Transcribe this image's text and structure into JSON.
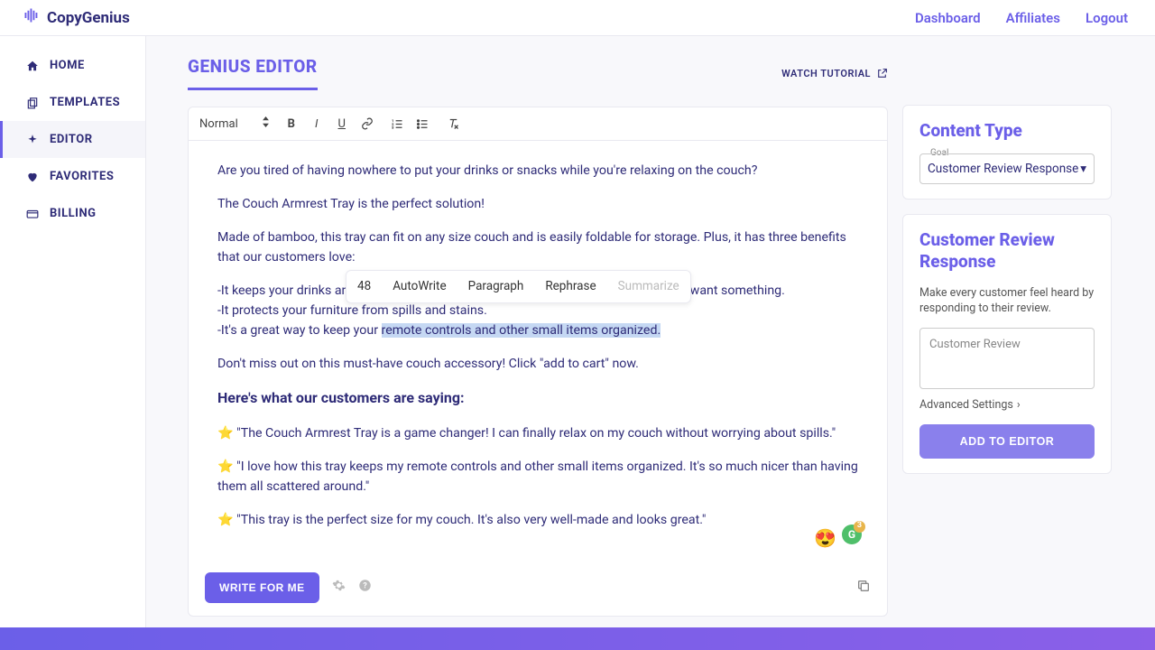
{
  "brand": "CopyGenius",
  "header_links": {
    "dashboard": "Dashboard",
    "affiliates": "Affiliates",
    "logout": "Logout"
  },
  "sidebar": [
    {
      "label": "HOME",
      "name": "home"
    },
    {
      "label": "TEMPLATES",
      "name": "templates"
    },
    {
      "label": "EDITOR",
      "name": "editor",
      "active": true
    },
    {
      "label": "FAVORITES",
      "name": "favorites"
    },
    {
      "label": "BILLING",
      "name": "billing"
    }
  ],
  "page_title": "GENIUS EDITOR",
  "tutorial": "WATCH TUTORIAL",
  "toolbar": {
    "style": "Normal"
  },
  "doc": {
    "p1": "Are you tired of having nowhere to put your drinks or snacks while you're relaxing on the couch?",
    "p2": "The Couch Armrest Tray is the perfect solution!",
    "p3": "Made of bamboo, this tray can fit on any size couch and is easily foldable for storage. Plus, it has three benefits that our customers love:",
    "b1a": "-It keeps your drinks and snac",
    "b1b": "ou want something.",
    "b2": "-It protects your furniture from spills and stains.",
    "b3a": "-It's a great way to keep your ",
    "b3_hl": "remote controls and other small items organized.",
    "p4": "Don't miss out on this must-have couch accessory! Click \"add to cart\" now.",
    "h1": "Here's what our customers are saying:",
    "r1": "⭐ \"The Couch Armrest Tray is a game changer! I can finally relax on my couch without worrying about spills.\"",
    "r2": "⭐ \"I love how this tray keeps my remote controls and other small items organized. It's so much nicer than having them all scattered around.\"",
    "r3": "⭐ \"This tray is the perfect size for my couch. It's also very well-made and looks great.\""
  },
  "popup": {
    "count": "48",
    "a": "AutoWrite",
    "b": "Paragraph",
    "c": "Rephrase",
    "d": "Summarize"
  },
  "write_btn": "WRITE FOR ME",
  "content_type": {
    "title": "Content Type",
    "goal_label": "Goal",
    "goal_value": "Customer Review Response"
  },
  "response_panel": {
    "title": "Customer Review Response",
    "desc": "Make every customer feel heard by responding to their review.",
    "placeholder": "Customer Review",
    "adv": "Advanced Settings",
    "btn": "ADD TO EDITOR"
  }
}
